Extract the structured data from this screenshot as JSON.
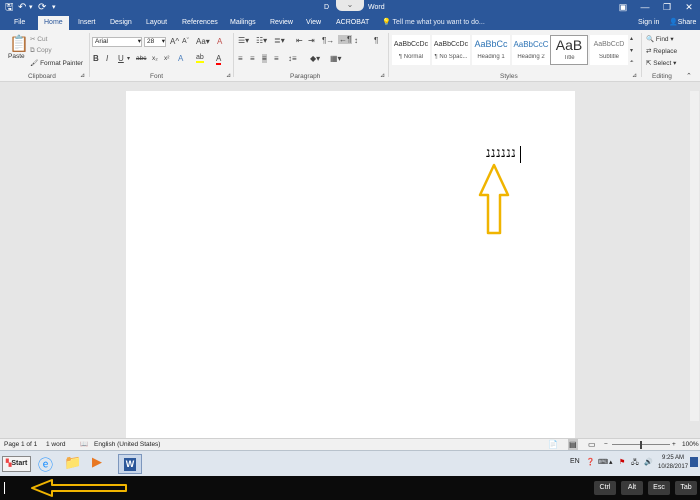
{
  "app": {
    "title_fragment_left": "D",
    "title_fragment_right": "Word"
  },
  "quick_access": {
    "save_icon": "save-icon",
    "undo_icon": "undo-icon",
    "redo_icon": "redo-icon",
    "customize_icon": "customize-icon"
  },
  "window_buttons": {
    "restore": "⧉",
    "minimize": "—",
    "maximize": "❐",
    "close": "✕"
  },
  "tabs": [
    "File",
    "Home",
    "Insert",
    "Design",
    "Layout",
    "References",
    "Mailings",
    "Review",
    "View",
    "ACROBAT"
  ],
  "tell_me": "Tell me what you want to do...",
  "signin": "Sign in",
  "share": "Share",
  "clipboard": {
    "paste": "Paste",
    "cut": "Cut",
    "copy": "Copy",
    "format_painter": "Format Painter",
    "label": "Clipboard"
  },
  "font": {
    "name": "Arial",
    "size": "28",
    "grow": "A",
    "shrink": "A",
    "case": "Aa",
    "clear": "A",
    "bold": "B",
    "italic": "I",
    "underline": "U",
    "strike": "abc",
    "subscript": "x₂",
    "superscript": "x²",
    "effects": "A",
    "highlight": "ab",
    "color": "A",
    "label": "Font"
  },
  "paragraph": {
    "label": "Paragraph",
    "pilcrow": "¶"
  },
  "styles": {
    "items": [
      {
        "preview": "AaBbCcDc",
        "name": "¶ Normal"
      },
      {
        "preview": "AaBbCcDc",
        "name": "¶ No Spac..."
      },
      {
        "preview": "AaBbCc",
        "name": "Heading 1"
      },
      {
        "preview": "AaBbCcC",
        "name": "Heading 2"
      },
      {
        "preview": "AaB",
        "name": "Title"
      },
      {
        "preview": "AaBbCcD",
        "name": "Subtitle"
      }
    ],
    "label": "Styles"
  },
  "editing": {
    "find": "Find",
    "replace": "Replace",
    "select": "Select",
    "label": "Editing"
  },
  "document": {
    "text": "ננננננ"
  },
  "status": {
    "page": "Page 1 of 1",
    "words": "1 word",
    "language": "English (United States)",
    "zoom": "100%"
  },
  "taskbar": {
    "start": "Start",
    "lang": "EN",
    "time": "9:25 AM",
    "date": "10/28/2017"
  },
  "keyboard": {
    "keys": [
      "Ctrl",
      "Alt",
      "Esc",
      "Tab"
    ]
  }
}
